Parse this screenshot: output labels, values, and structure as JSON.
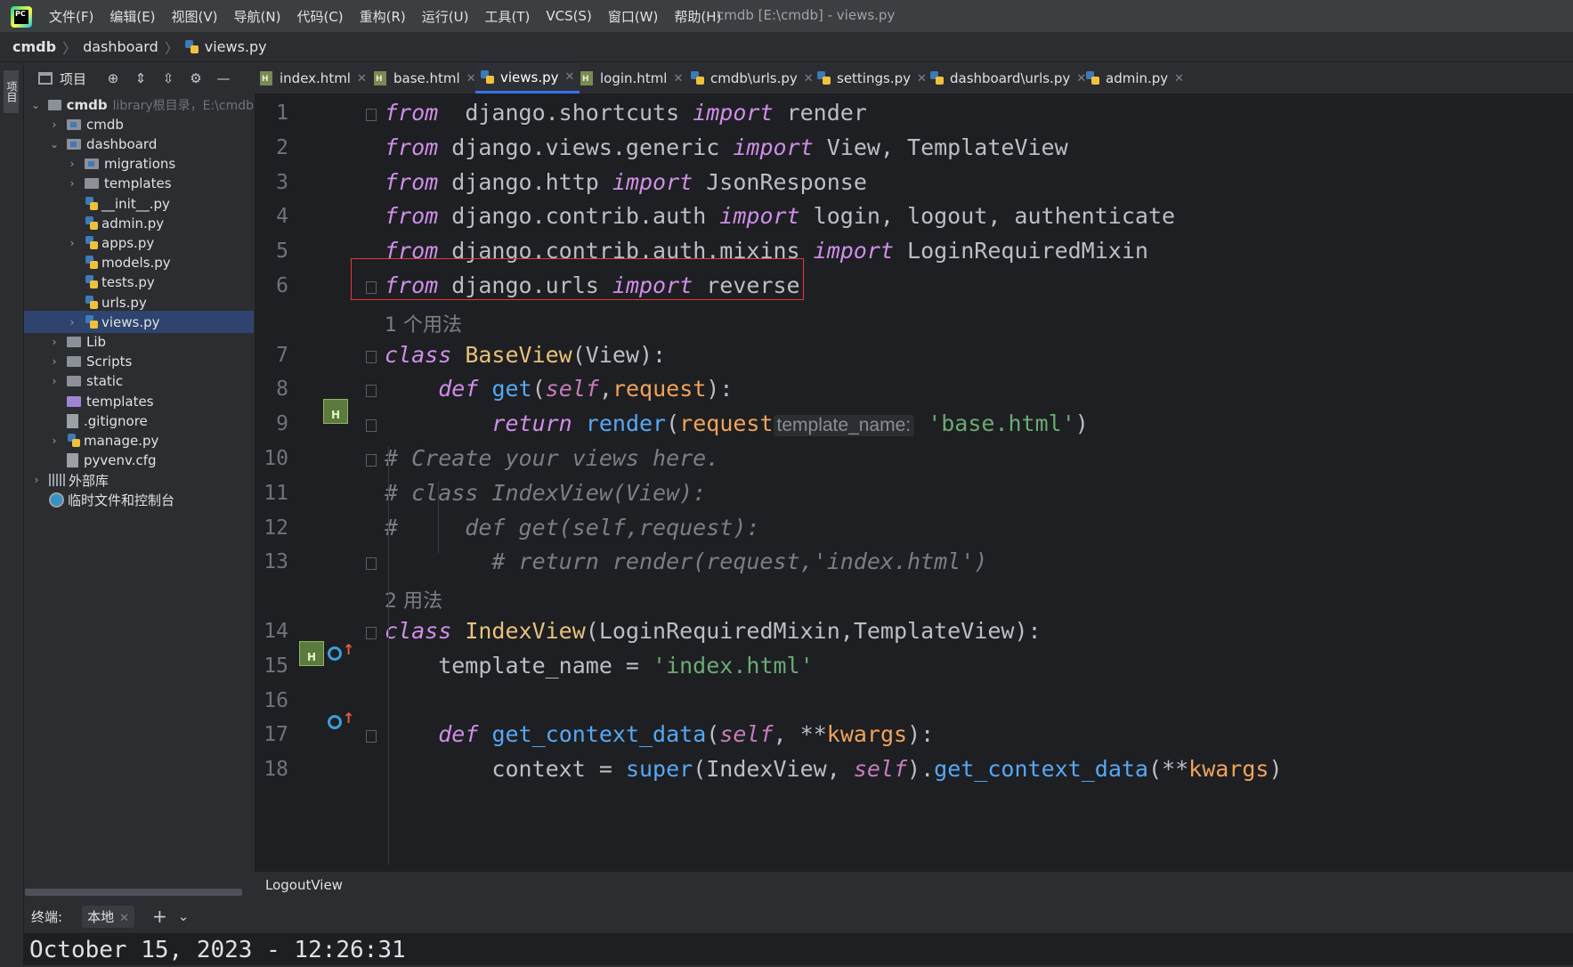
{
  "app": {
    "menu": [
      "文件(F)",
      "编辑(E)",
      "视图(V)",
      "导航(N)",
      "代码(C)",
      "重构(R)",
      "运行(U)",
      "工具(T)",
      "VCS(S)",
      "窗口(W)",
      "帮助(H)"
    ],
    "window_title": "cmdb [E:\\cmdb] - views.py",
    "logo_text": "PC",
    "accent_color": "#3574f0"
  },
  "breadcrumb": [
    "cmdb",
    "dashboard",
    "views.py"
  ],
  "left_strip": {
    "label": "项目"
  },
  "project_panel": {
    "title": "项目",
    "toolbar_icons": [
      "locate-icon",
      "expand-all-icon",
      "collapse-all-icon",
      "gear-icon",
      "minimize-icon"
    ],
    "tree": [
      {
        "label": "cmdb",
        "hint": "library根目录，E:\\cmdb",
        "level": 0,
        "kind": "folder",
        "expanded": true
      },
      {
        "label": "cmdb",
        "level": 1,
        "kind": "module",
        "expanded": false
      },
      {
        "label": "dashboard",
        "level": 1,
        "kind": "module",
        "expanded": true
      },
      {
        "label": "migrations",
        "level": 2,
        "kind": "module",
        "expanded": false
      },
      {
        "label": "templates",
        "level": 2,
        "kind": "folder",
        "expanded": false
      },
      {
        "label": "__init__.py",
        "level": 2,
        "kind": "py"
      },
      {
        "label": "admin.py",
        "level": 2,
        "kind": "py"
      },
      {
        "label": "apps.py",
        "level": 2,
        "kind": "py",
        "expanded": false
      },
      {
        "label": "models.py",
        "level": 2,
        "kind": "py"
      },
      {
        "label": "tests.py",
        "level": 2,
        "kind": "py"
      },
      {
        "label": "urls.py",
        "level": 2,
        "kind": "py"
      },
      {
        "label": "views.py",
        "level": 2,
        "kind": "py",
        "expanded": false,
        "selected": true
      },
      {
        "label": "Lib",
        "level": 1,
        "kind": "folder",
        "expanded": false
      },
      {
        "label": "Scripts",
        "level": 1,
        "kind": "folder",
        "expanded": false
      },
      {
        "label": "static",
        "level": 1,
        "kind": "folder",
        "expanded": false
      },
      {
        "label": "templates",
        "level": 1,
        "kind": "folder-purple"
      },
      {
        "label": ".gitignore",
        "level": 1,
        "kind": "file"
      },
      {
        "label": "manage.py",
        "level": 1,
        "kind": "py",
        "expanded": false
      },
      {
        "label": "pyvenv.cfg",
        "level": 1,
        "kind": "file"
      },
      {
        "label": "外部库",
        "level": 0,
        "kind": "lib",
        "expanded": false
      },
      {
        "label": "临时文件和控制台",
        "level": 0,
        "kind": "scratch"
      }
    ]
  },
  "tabs": [
    {
      "label": "index.html",
      "kind": "html"
    },
    {
      "label": "base.html",
      "kind": "html"
    },
    {
      "label": "views.py",
      "kind": "py",
      "active": true
    },
    {
      "label": "login.html",
      "kind": "html"
    },
    {
      "label": "cmdb\\urls.py",
      "kind": "py"
    },
    {
      "label": "settings.py",
      "kind": "py"
    },
    {
      "label": "dashboard\\urls.py",
      "kind": "py"
    },
    {
      "label": "admin.py",
      "kind": "py"
    }
  ],
  "editor": {
    "lines": [
      {
        "n": "1",
        "tokens": [
          [
            "kw",
            "from"
          ],
          [
            "",
            "  django.shortcuts "
          ],
          [
            "kw",
            "import"
          ],
          [
            "",
            " render"
          ]
        ]
      },
      {
        "n": "2",
        "tokens": [
          [
            "kw",
            "from"
          ],
          [
            "",
            " django.views.generic "
          ],
          [
            "kw",
            "import"
          ],
          [
            "",
            " View, TemplateView"
          ]
        ]
      },
      {
        "n": "3",
        "tokens": [
          [
            "kw",
            "from"
          ],
          [
            "",
            " django.http "
          ],
          [
            "kw",
            "import"
          ],
          [
            "",
            " JsonResponse"
          ]
        ]
      },
      {
        "n": "4",
        "tokens": [
          [
            "kw",
            "from"
          ],
          [
            "",
            " django.contrib.auth "
          ],
          [
            "kw",
            "import"
          ],
          [
            "",
            " login, logout, authenticate"
          ]
        ]
      },
      {
        "n": "5",
        "tokens": [
          [
            "kw",
            "from"
          ],
          [
            "",
            " django.contrib.auth.mixins "
          ],
          [
            "kw",
            "import"
          ],
          [
            "",
            " LoginRequiredMixin"
          ]
        ]
      },
      {
        "n": "6",
        "tokens": [
          [
            "kw",
            "from"
          ],
          [
            "",
            " django.urls "
          ],
          [
            "kw",
            "import"
          ],
          [
            "",
            " reverse"
          ]
        ]
      },
      {
        "usage": "1 个用法"
      },
      {
        "n": "7",
        "tokens": [
          [
            "kw",
            "class"
          ],
          [
            "",
            " "
          ],
          [
            "cls",
            "BaseView"
          ],
          [
            "",
            "(View):"
          ]
        ]
      },
      {
        "n": "8",
        "tokens": [
          [
            "",
            "    "
          ],
          [
            "kw",
            "def"
          ],
          [
            "",
            " "
          ],
          [
            "fn",
            "get"
          ],
          [
            "",
            "("
          ],
          [
            "self",
            "self"
          ],
          [
            "",
            ","
          ],
          [
            "prm",
            "request"
          ],
          [
            "",
            "):"
          ]
        ]
      },
      {
        "n": "9",
        "tokens": [
          [
            "",
            "        "
          ],
          [
            "kw",
            "return"
          ],
          [
            "",
            " "
          ],
          [
            "bi",
            "render"
          ],
          [
            "",
            "("
          ],
          [
            "prm",
            "request"
          ],
          [
            ", "
          ],
          [
            "hint",
            "template_name:"
          ],
          [
            "",
            " "
          ],
          [
            "str",
            "'base.html'"
          ],
          [
            "",
            ")"
          ]
        ]
      },
      {
        "n": "10",
        "tokens": [
          [
            "cmt",
            "# Create your views here."
          ]
        ]
      },
      {
        "n": "11",
        "tokens": [
          [
            "cmt",
            "# class IndexView(View):"
          ]
        ]
      },
      {
        "n": "12",
        "tokens": [
          [
            "cmt",
            "#     def get(self,request):"
          ]
        ]
      },
      {
        "n": "13",
        "tokens": [
          [
            "cmt",
            "        # return render(request,'index.html')"
          ]
        ]
      },
      {
        "usage": "2 用法"
      },
      {
        "n": "14",
        "tokens": [
          [
            "kw",
            "class"
          ],
          [
            "",
            " "
          ],
          [
            "cls",
            "IndexView"
          ],
          [
            "",
            "(LoginRequiredMixin,TemplateView):"
          ]
        ]
      },
      {
        "n": "15",
        "tokens": [
          [
            "",
            "    template_name = "
          ],
          [
            "str",
            "'index.html'"
          ]
        ]
      },
      {
        "n": "16",
        "tokens": []
      },
      {
        "n": "17",
        "tokens": [
          [
            "",
            "    "
          ],
          [
            "kw",
            "def"
          ],
          [
            "",
            " "
          ],
          [
            "fn",
            "get_context_data"
          ],
          [
            "",
            "("
          ],
          [
            "self",
            "self"
          ],
          [
            "",
            ", **"
          ],
          [
            "prm",
            "kwargs"
          ],
          [
            "",
            "):"
          ]
        ]
      },
      {
        "n": "18",
        "tokens": [
          [
            "",
            "        context = "
          ],
          [
            "bi",
            "super"
          ],
          [
            "",
            "(IndexView, "
          ],
          [
            "self",
            "self"
          ],
          [
            "",
            ")."
          ],
          [
            "fn",
            "get_context_data"
          ],
          [
            "",
            "(**"
          ],
          [
            "prm",
            "kwargs"
          ],
          [
            "",
            ")"
          ]
        ]
      }
    ]
  },
  "structure_bar": {
    "label": "LogoutView"
  },
  "terminal": {
    "label": "终端:",
    "tab_label": "本地",
    "output": "October 15, 2023 - 12:26:31"
  }
}
